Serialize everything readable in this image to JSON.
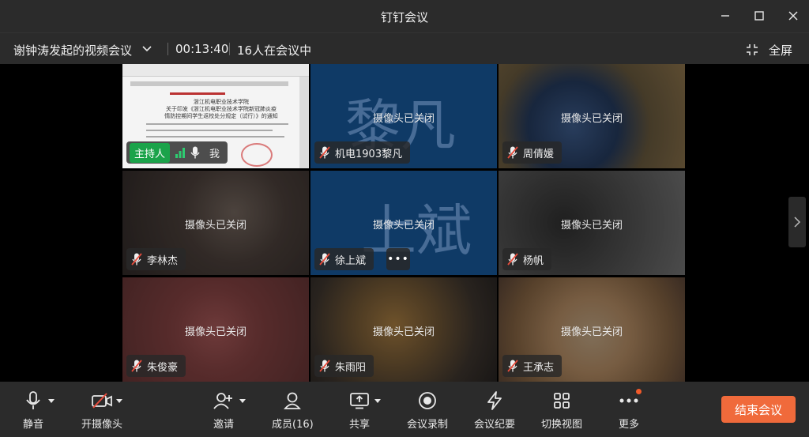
{
  "window": {
    "title": "钉钉会议"
  },
  "infobar": {
    "meeting_name": "谢钟涛发起的视频会议",
    "timer": "00:13:40",
    "participants_count": "16人在会议中",
    "fullscreen_label": "全屏"
  },
  "tiles": [
    {
      "name": "我",
      "host_label": "主持人",
      "camera_off": false,
      "mic": "on",
      "content": "screen-share"
    },
    {
      "name": "机电1903黎凡",
      "camera_off": true,
      "camera_off_text": "摄像头已关闭",
      "avatar_text": "黎凡",
      "mic": "muted"
    },
    {
      "name": "周倩媛",
      "camera_off": true,
      "camera_off_text": "摄像头已关闭",
      "mic": "muted"
    },
    {
      "name": "李林杰",
      "camera_off": true,
      "camera_off_text": "摄像头已关闭",
      "mic": "muted"
    },
    {
      "name": "徐上斌",
      "camera_off": true,
      "camera_off_text": "摄像头已关闭",
      "avatar_text": "上斌",
      "mic": "muted",
      "more_button": "•••"
    },
    {
      "name": "杨帆",
      "camera_off": true,
      "camera_off_text": "摄像头已关闭",
      "mic": "muted"
    },
    {
      "name": "朱俊豪",
      "camera_off": true,
      "camera_off_text": "摄像头已关闭",
      "mic": "muted"
    },
    {
      "name": "朱雨阳",
      "camera_off": true,
      "camera_off_text": "摄像头已关闭",
      "mic": "muted"
    },
    {
      "name": "王承志",
      "camera_off": true,
      "camera_off_text": "摄像头已关闭",
      "mic": "muted"
    }
  ],
  "host_tile_doc": {
    "heading1": "浙江机电职业技术学院",
    "heading2": "关于印发《浙江机电职业技术学院新冠肺炎疫",
    "heading3": "情防控期间学生返校处分规定（试行）》的通知"
  },
  "toolbar": {
    "mute": "静音",
    "camera": "开摄像头",
    "invite": "邀请",
    "members": "成员(16)",
    "share": "共享",
    "record": "会议录制",
    "minutes": "会议纪要",
    "switch_view": "切换视图",
    "more": "更多",
    "end_meeting": "结束会议"
  },
  "colors": {
    "accent_end": "#f06a3b",
    "host_badge": "#1ba34a",
    "notify_dot": "#f25a2a",
    "signal_green": "#2ecc71"
  }
}
